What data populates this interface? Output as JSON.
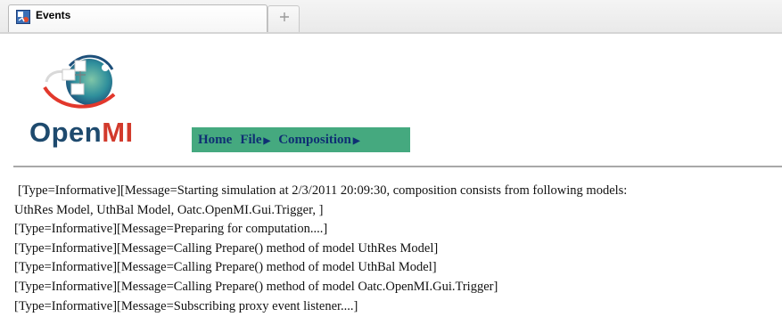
{
  "tabs": {
    "active_label": "Events",
    "new_tab_icon": "plus-icon"
  },
  "logo": {
    "text_main": "Open",
    "text_accent": "MI"
  },
  "menu": {
    "items": [
      {
        "label": "Home",
        "has_submenu": false
      },
      {
        "label": "File",
        "has_submenu": true
      },
      {
        "label": "Composition",
        "has_submenu": true
      }
    ]
  },
  "log": {
    "lines": [
      " [Type=Informative][Message=Starting simulation at 2/3/2011 20:09:30, composition consists from following models:",
      "UthRes Model, UthBal Model, Oatc.OpenMI.Gui.Trigger, ]",
      "[Type=Informative][Message=Preparing for computation....]",
      "[Type=Informative][Message=Calling Prepare() method of model UthRes Model]",
      "[Type=Informative][Message=Calling Prepare() method of model UthBal Model]",
      "[Type=Informative][Message=Calling Prepare() method of model Oatc.OpenMI.Gui.Trigger]",
      "[Type=Informative][Message=Subscribing proxy event listener....]"
    ]
  },
  "colors": {
    "menu_bg": "#45a97f",
    "menu_text": "#0f2f73",
    "logo_blue": "#1e4a6e",
    "logo_red": "#d23a2c"
  }
}
